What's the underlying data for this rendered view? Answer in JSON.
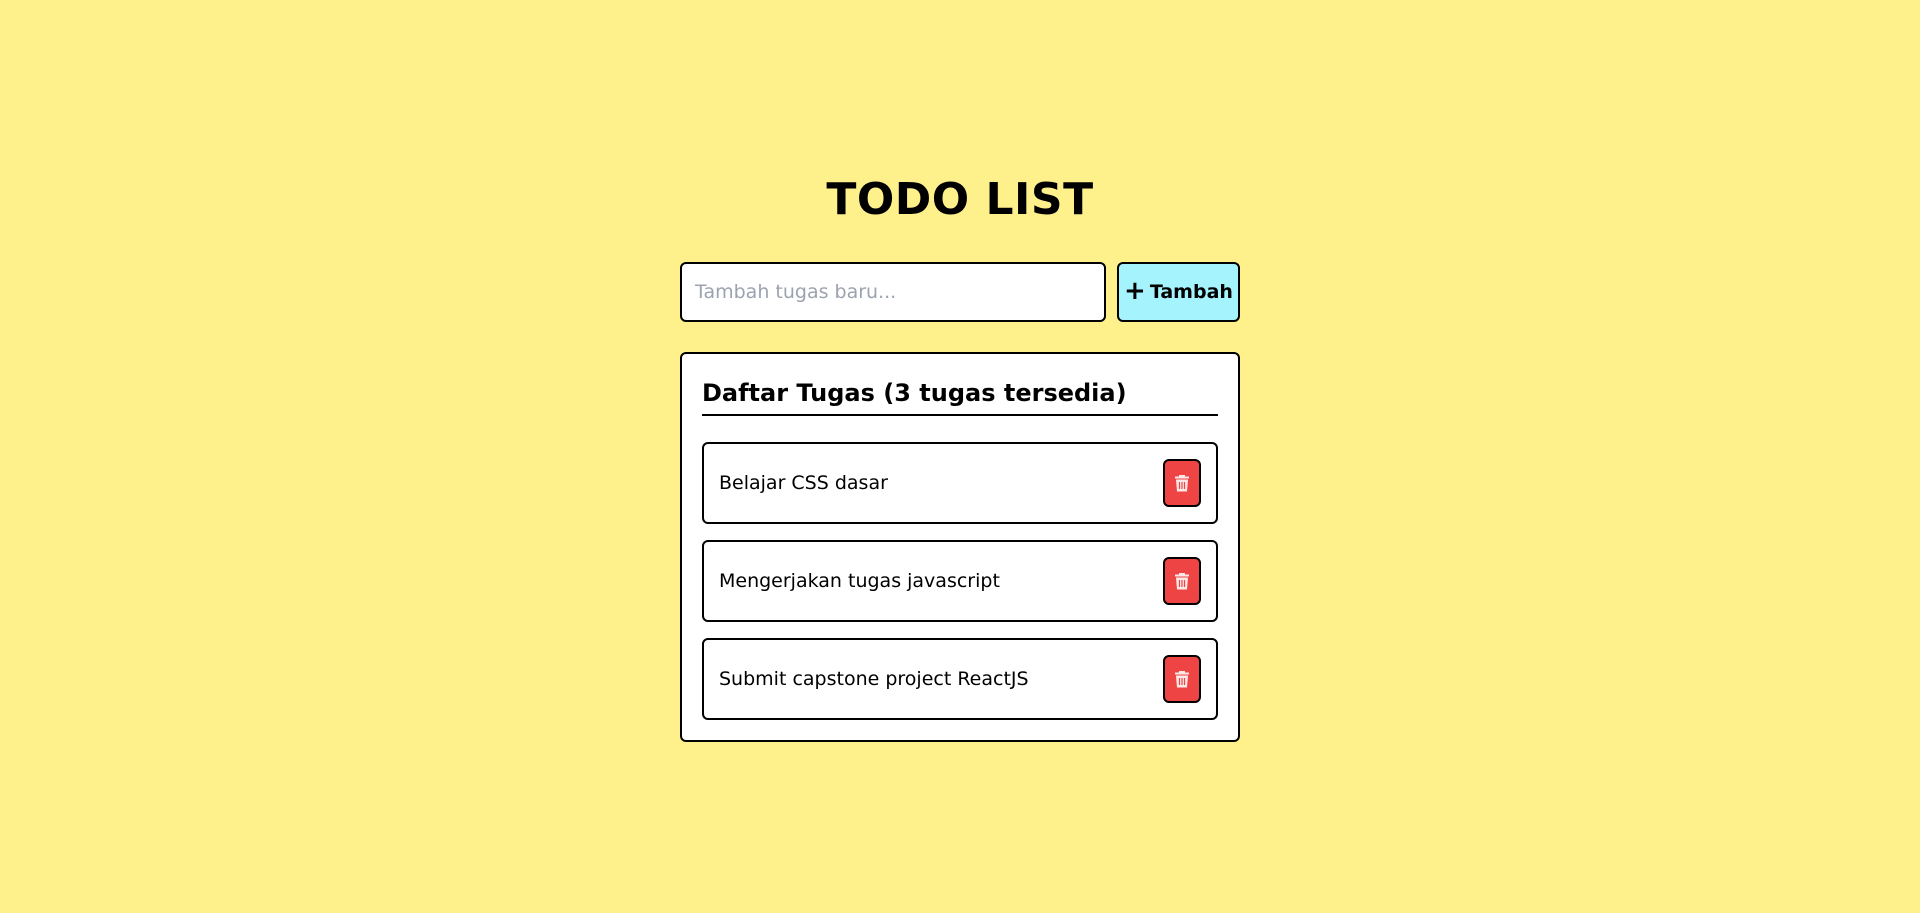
{
  "app": {
    "title": "TODO LIST"
  },
  "new_task": {
    "placeholder": "Tambah tugas baru...",
    "value": "",
    "add_label": "Tambah",
    "add_icon": "plus-icon"
  },
  "task_list": {
    "header": "Daftar Tugas (3 tugas tersedia)",
    "items": [
      {
        "label": "Belajar CSS dasar",
        "action_icon": "trash-icon"
      },
      {
        "label": "Mengerjakan tugas javascript",
        "action_icon": "trash-icon"
      },
      {
        "label": "Submit capstone project ReactJS",
        "action_icon": "trash-icon"
      }
    ]
  },
  "colors": {
    "background": "#fef08a",
    "add_button": "#a5f3fc",
    "delete_button": "#ef4444",
    "border": "#000000",
    "placeholder": "#9ca3af"
  }
}
